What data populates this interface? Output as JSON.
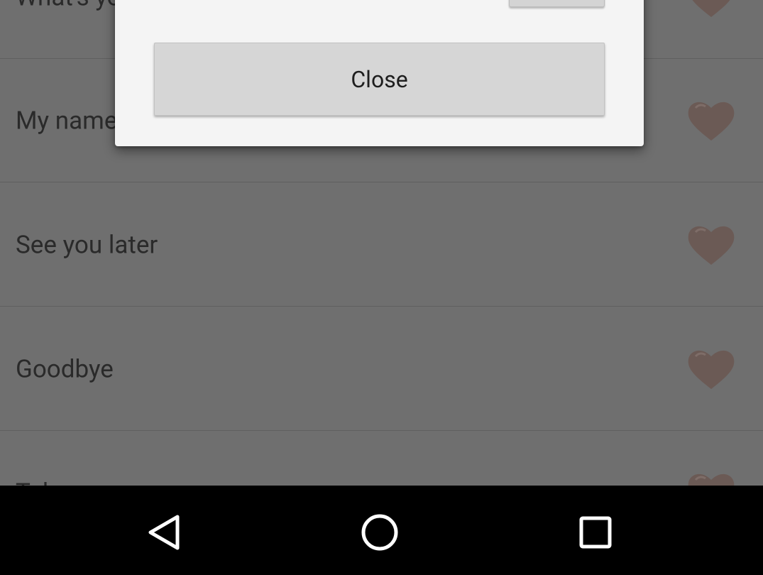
{
  "list": {
    "items": [
      {
        "label": "What's your name?",
        "favorite_icon": "heart-icon"
      },
      {
        "label": "My name is...",
        "favorite_icon": "heart-icon"
      },
      {
        "label": "See you later",
        "favorite_icon": "heart-icon"
      },
      {
        "label": "Goodbye",
        "favorite_icon": "heart-icon"
      },
      {
        "label": "Take care",
        "favorite_icon": "heart-icon"
      }
    ]
  },
  "dialog": {
    "close_label": "Close"
  },
  "navbar": {
    "back_icon": "back-triangle-icon",
    "home_icon": "home-circle-icon",
    "recents_icon": "recents-square-icon"
  },
  "colors": {
    "dim_background": "#6f6f6f",
    "heart": "#6b5a55",
    "dialog_background": "#f4f4f4",
    "button_background": "#d6d6d6",
    "navbar": "#000000"
  }
}
